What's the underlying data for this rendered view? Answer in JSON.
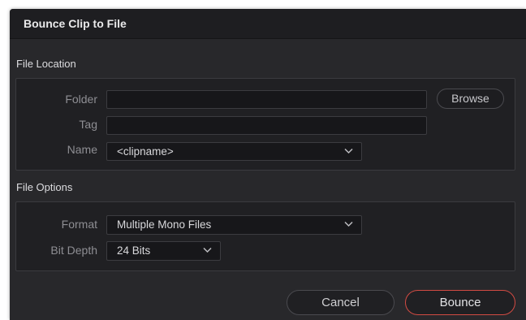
{
  "dialog": {
    "title": "Bounce Clip to File"
  },
  "file_location": {
    "section_label": "File Location",
    "folder_label": "Folder",
    "folder_value": "",
    "browse_label": "Browse",
    "tag_label": "Tag",
    "tag_value": "",
    "name_label": "Name",
    "name_value": "<clipname>"
  },
  "file_options": {
    "section_label": "File Options",
    "format_label": "Format",
    "format_value": "Multiple Mono Files",
    "bitdepth_label": "Bit Depth",
    "bitdepth_value": "24 Bits"
  },
  "footer": {
    "cancel_label": "Cancel",
    "bounce_label": "Bounce"
  },
  "colors": {
    "accent": "#d24b43",
    "panel": "#28282b"
  },
  "icons": [
    "chevron-down-icon"
  ]
}
